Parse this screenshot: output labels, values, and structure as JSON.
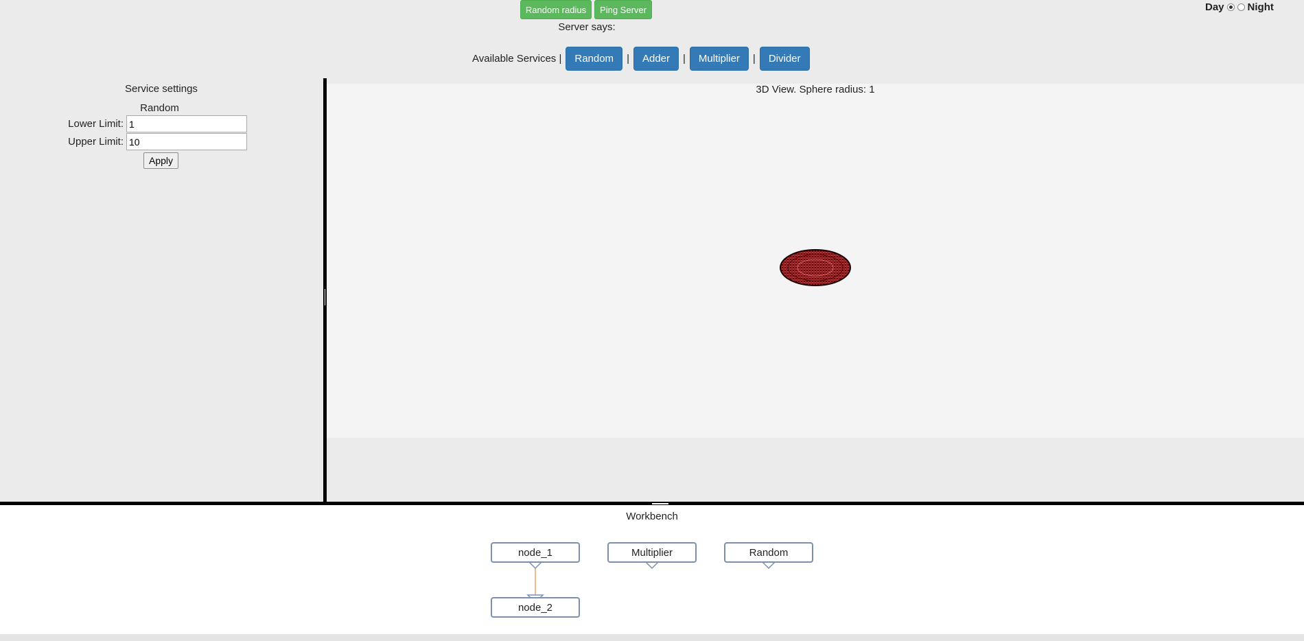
{
  "topbar": {
    "random_radius_label": "Random radius",
    "ping_server_label": "Ping Server",
    "server_says": "Server says:",
    "theme": {
      "day_label": "Day",
      "night_label": "Night",
      "selected": "Day"
    }
  },
  "services": {
    "label": "Available Services |",
    "separator": "|",
    "buttons": [
      "Random",
      "Adder",
      "Multiplier",
      "Divider"
    ]
  },
  "settings": {
    "title": "Service settings",
    "service_name": "Random",
    "lower_label": "Lower Limit:",
    "lower_value": "1",
    "upper_label": "Upper Limit:",
    "upper_value": "10",
    "apply_label": "Apply"
  },
  "view3d": {
    "title": "3D View. Sphere radius: 1",
    "sphere_color": "#c0282d"
  },
  "workbench": {
    "title": "Workbench",
    "nodes": [
      "node_1",
      "Multiplier",
      "Random",
      "node_2"
    ],
    "link_color": "#f0a070",
    "node_border_color": "#7a90ac"
  },
  "colors": {
    "green_button": "#5cb85c",
    "blue_button": "#337ab7"
  }
}
